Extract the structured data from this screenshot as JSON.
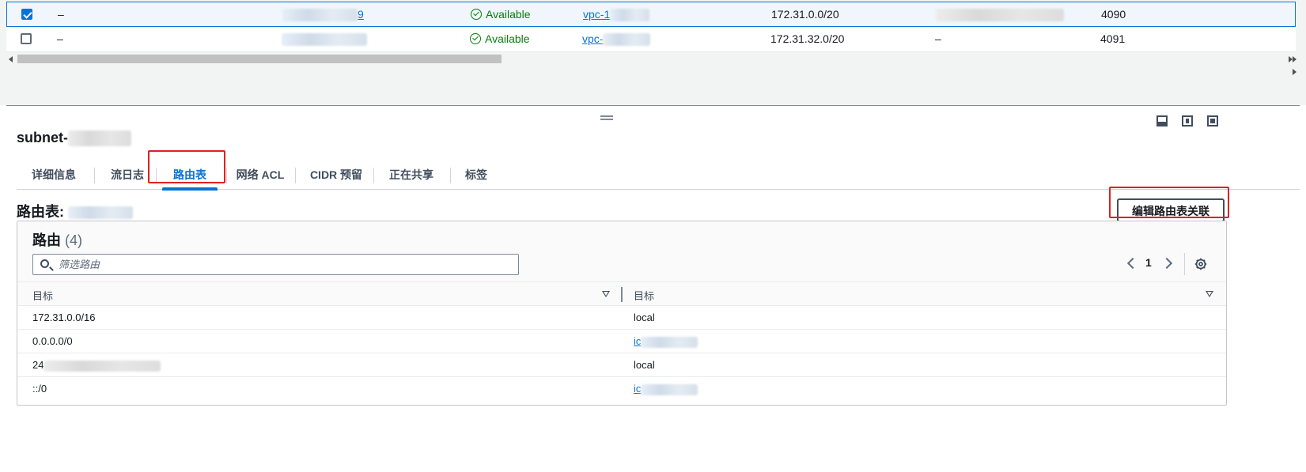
{
  "subnet_table": {
    "rows": [
      {
        "checked": true,
        "name": "–",
        "subnet_id_visible": "9",
        "status": "Available",
        "vpc_prefix": "vpc-1",
        "cidr": "172.31.0.0/20",
        "ipv6": "",
        "ips": "4090"
      },
      {
        "checked": false,
        "name": "–",
        "subnet_id_visible": "",
        "status": "Available",
        "vpc_prefix": "vpc-",
        "cidr": "172.31.32.0/20",
        "ipv6": "–",
        "ips": "4091"
      }
    ]
  },
  "detail": {
    "subnet_title": "subnet-",
    "tabs": [
      {
        "label": "详细信息",
        "active": false
      },
      {
        "label": "流日志",
        "active": false
      },
      {
        "label": "路由表",
        "active": true
      },
      {
        "label": "网络 ACL",
        "active": false
      },
      {
        "label": "CIDR 预留",
        "active": false
      },
      {
        "label": "正在共享",
        "active": false
      },
      {
        "label": "标签",
        "active": false
      }
    ],
    "route_table_label": "路由表:",
    "edit_button": "编辑路由表关联"
  },
  "routes": {
    "title": "路由",
    "count": "(4)",
    "filter_placeholder": "筛选路由",
    "page": "1",
    "columns": [
      "目标",
      "目标"
    ],
    "rows": [
      {
        "destination": "172.31.0.0/16",
        "target": "local",
        "target_is_link": false
      },
      {
        "destination": "0.0.0.0/0",
        "target": "ic",
        "target_is_link": true
      },
      {
        "destination": "24",
        "target": "local",
        "target_is_link": false
      },
      {
        "destination": "::/0",
        "target": "ic",
        "target_is_link": true
      }
    ]
  },
  "colors": {
    "accent": "#0972d3",
    "success": "#037f0c",
    "highlight": "#e02020"
  }
}
